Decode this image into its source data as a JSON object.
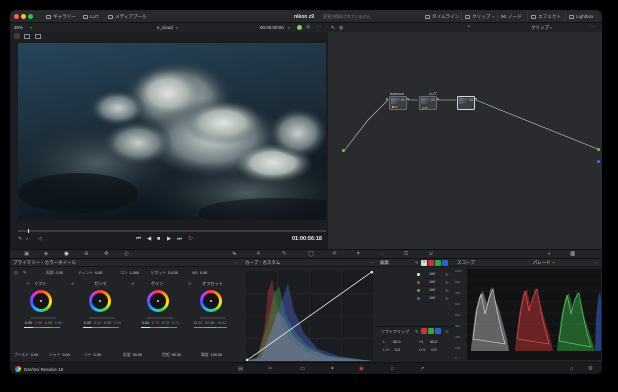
{
  "app": {
    "window_title": "nikon z9",
    "window_subtitle": "変更が保存されていません",
    "status_app": "DaVinci Resolve 18"
  },
  "titlebar": {
    "left_items": [
      "ギャラリー",
      "LUT",
      "メディアプール"
    ],
    "right_items": [
      "タイムライン",
      "クリップ",
      "ノード",
      "エフェクト",
      "Lightbox"
    ]
  },
  "viewer": {
    "zoom": "30%",
    "clip_name": "e_cloud",
    "timecode_top": "00:00:00:00",
    "timecode": "01:00:56:18"
  },
  "node_bar": {
    "clip_label": "クリップ"
  },
  "nodes": [
    {
      "label": "balance",
      "number": "01"
    },
    {
      "label": "LUT",
      "number": "02"
    },
    {
      "label": "",
      "number": "03"
    }
  ],
  "color_wheels": {
    "title": "プライマリー・カラーホイール",
    "top_fields": [
      {
        "label": "再調",
        "value": "0.00"
      },
      {
        "label": "ティント",
        "value": "0.00"
      },
      {
        "label": "コン",
        "value": "1.000"
      },
      {
        "label": "ピボット",
        "value": "0.435"
      },
      {
        "label": "MD",
        "value": "0.00"
      }
    ],
    "wheels": [
      {
        "label": "リフト",
        "values": [
          "0.00",
          "0.00",
          "0.00",
          "0.00"
        ]
      },
      {
        "label": "ガンマ",
        "values": [
          "0.00",
          "0.00",
          "0.00",
          "0.00"
        ]
      },
      {
        "label": "ゲイン",
        "values": [
          "0.84",
          "0.73",
          "0.72",
          "0.71"
        ]
      },
      {
        "label": "オフセット",
        "values": [
          "26.65",
          "22.56",
          "18.81",
          ""
        ]
      }
    ],
    "bottom_fields": [
      {
        "label": "ブースト",
        "value": "0.00"
      },
      {
        "label": "シャド",
        "value": "0.00"
      },
      {
        "label": "ハイ",
        "value": "0.00"
      },
      {
        "label": "彩度",
        "value": "50.00"
      },
      {
        "label": "色相",
        "value": "50.00"
      },
      {
        "label": "輝度",
        "value": "100.00"
      }
    ]
  },
  "curves": {
    "title": "カーブ - カスタム"
  },
  "edit_panel": {
    "title": "編集",
    "channels": [
      {
        "color": "#e8e8e8",
        "value": "100"
      },
      {
        "color": "#e03a3a",
        "value": "100"
      },
      {
        "color": "#3ac44a",
        "value": "100"
      },
      {
        "color": "#3a6ae0",
        "value": "100"
      }
    ],
    "soft_clip_title": "ソフトクリップ",
    "soft_clip_fields": [
      {
        "label": "L",
        "value": "50.0"
      },
      {
        "label": "HL",
        "value": "50.0"
      },
      {
        "label": "L.S.",
        "value": "0.0"
      },
      {
        "label": "H.S.",
        "value": "0.0"
      }
    ]
  },
  "scope": {
    "title": "スコープ",
    "mode": "パレード",
    "scale": [
      "1023",
      "896",
      "768",
      "640",
      "512",
      "384",
      "256",
      "128",
      "0"
    ]
  }
}
